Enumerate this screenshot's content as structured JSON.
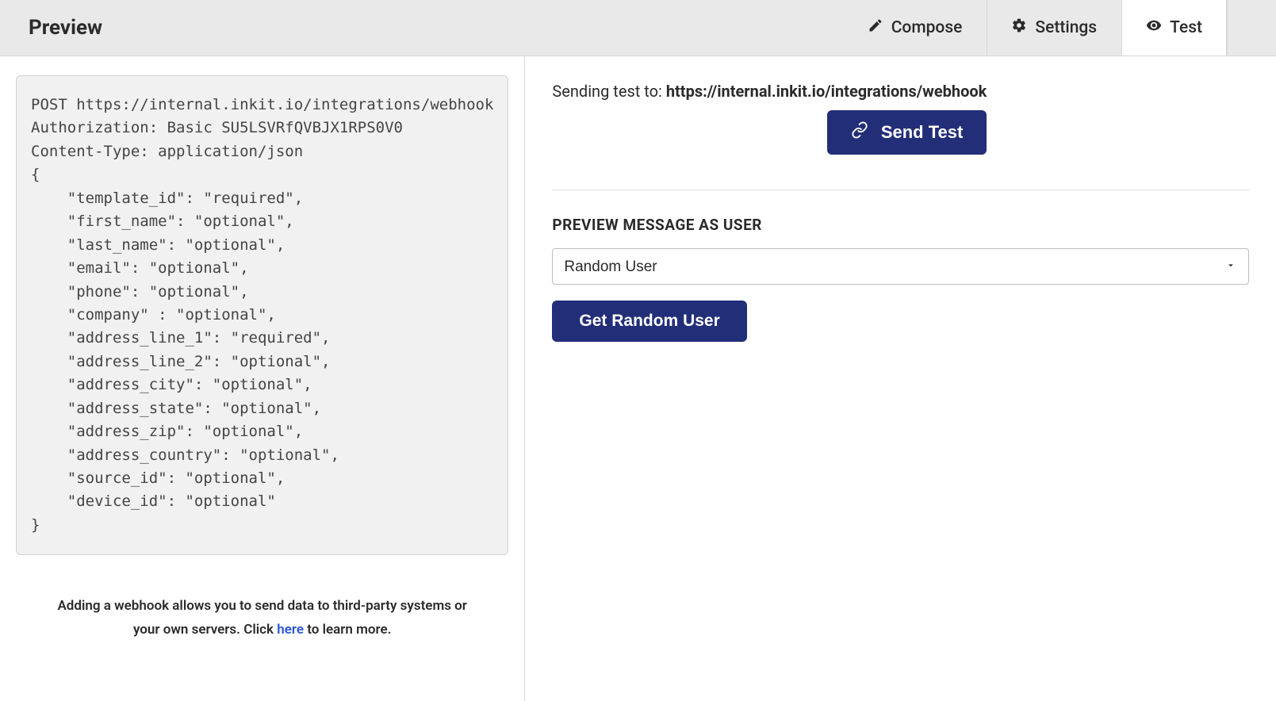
{
  "header": {
    "title": "Preview",
    "tabs": {
      "compose": "Compose",
      "settings": "Settings",
      "test": "Test"
    }
  },
  "code": {
    "line1": "POST https://internal.inkit.io/integrations/webhook",
    "line2": "Authorization: Basic SU5LSVRfQVBJX1RPS0V0",
    "line3": "Content-Type: application/json",
    "body_open": "{",
    "fields": [
      "    \"template_id\": \"required\",",
      "    \"first_name\": \"optional\",",
      "    \"last_name\": \"optional\",",
      "    \"email\": \"optional\",",
      "    \"phone\": \"optional\",",
      "    \"company\" : \"optional\",",
      "    \"address_line_1\": \"required\",",
      "    \"address_line_2\": \"optional\",",
      "    \"address_city\": \"optional\",",
      "    \"address_state\": \"optional\",",
      "    \"address_zip\": \"optional\",",
      "    \"address_country\": \"optional\",",
      "    \"source_id\": \"optional\",",
      "    \"device_id\": \"optional\""
    ],
    "body_close": "}"
  },
  "help": {
    "prefix": "Adding a webhook allows you to send data to third-party systems or your own servers. Click ",
    "link": "here",
    "suffix": " to learn more."
  },
  "test_panel": {
    "sending_prefix": "Sending test to: ",
    "sending_url": "https://internal.inkit.io/integrations/webhook",
    "send_test_label": "Send Test",
    "preview_label": "PREVIEW MESSAGE AS USER",
    "select_value": "Random User",
    "get_random_label": "Get Random User"
  }
}
